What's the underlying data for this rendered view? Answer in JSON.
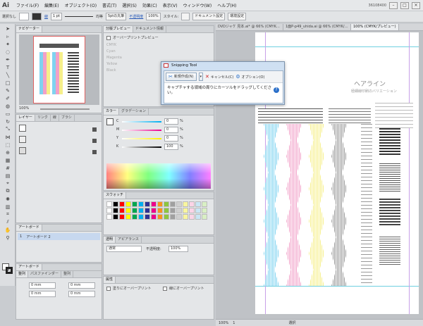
{
  "app": {
    "logo": "Ai",
    "menus": [
      "ファイル(F)",
      "編集(E)",
      "オブジェクト(O)",
      "書式(T)",
      "選択(S)",
      "効果(C)",
      "表示(V)",
      "ウィンドウ(W)",
      "ヘルプ(H)"
    ],
    "doc_id": "36108400"
  },
  "controlbar": {
    "selection": "選択なし",
    "stroke_label": "線",
    "stroke_weight": "1 pt",
    "stroke_style": "均等",
    "brush": "5ptの丸筆",
    "opacity_label": "不透明度",
    "opacity_value": "100%",
    "style_label": "スタイル:",
    "doc_settings": "ドキュメント設定",
    "env_settings": "環境設定"
  },
  "navigator": {
    "tabs": [
      "ナビゲーター"
    ],
    "zoom": "100%"
  },
  "layers": {
    "tabs": [
      "レイヤー",
      "リンク",
      "線",
      "ブラシ"
    ]
  },
  "artboards": {
    "tabs": [
      "アートボード"
    ],
    "items": [
      {
        "index": "1",
        "name": "アートボード 2"
      }
    ]
  },
  "align": {
    "tabs": [
      "整列",
      "パスファインダー",
      "整列"
    ],
    "fields": [
      "0 mm",
      "0 mm",
      "0 mm",
      "0 mm"
    ]
  },
  "separations": {
    "tabs": [
      "分版プレビュー",
      "ドキュメント情報"
    ],
    "overprint_label": "オーバープリントプレビュー",
    "inks": [
      "CMYK",
      "Cyan",
      "Magenta",
      "Yellow",
      "Black"
    ]
  },
  "color": {
    "tabs": [
      "カラー",
      "グラデーション"
    ],
    "channels": [
      {
        "label": "C",
        "value": "0",
        "unit": "%"
      },
      {
        "label": "M",
        "value": "0",
        "unit": "%"
      },
      {
        "label": "Y",
        "value": "0",
        "unit": "%"
      },
      {
        "label": "K",
        "value": "100",
        "unit": "%"
      }
    ]
  },
  "swatches": {
    "tabs": [
      "スウォッチ"
    ],
    "colors": [
      "#ffffff",
      "#000000",
      "#ff0000",
      "#ffff00",
      "#00a650",
      "#00aeef",
      "#2e3192",
      "#ec008c",
      "#f7941d",
      "#8dc63f",
      "#a0a0a0",
      "#d0d0d0",
      "#f8f59f",
      "#fbd4e6",
      "#c9e6f5",
      "#d9efc4"
    ]
  },
  "transparency": {
    "tabs": [
      "透明",
      "アピアランス"
    ],
    "mode": "通常",
    "opacity_label": "不透明度:",
    "opacity_value": "100%"
  },
  "attributes": {
    "tabs": [
      "属性"
    ],
    "overprint_fill": "塗りにオーバープリント",
    "overprint_stroke": "線にオーバープリント"
  },
  "documents": {
    "tabs": [
      "DVDジャケ 見本.ai* @ 66% (CMYK/プレビュー)",
      "1面P-p49_uhida.ai @ 66% (CMYK/プレビュー)",
      "100% (CMYK/プレビュー)"
    ],
    "status_zoom": "100%",
    "status_page": "1",
    "status_tool": "選択"
  },
  "artwork": {
    "heading": "ヘアライン",
    "subheading": "極細線印刷のバリエーション",
    "colors": {
      "cyan": "#7fd3f0",
      "magenta": "#f2a0c8",
      "yellow": "#f6ef8a",
      "gray": "#9a9a9a"
    }
  },
  "snipping_tool": {
    "title": "Snipping Tool",
    "new_button": "新規作成(N)",
    "cancel_button": "キャンセル(C)",
    "options_button": "オプション(O)",
    "message": "キャプチャする領域の周りにカーソルをドラッグしてください。"
  }
}
